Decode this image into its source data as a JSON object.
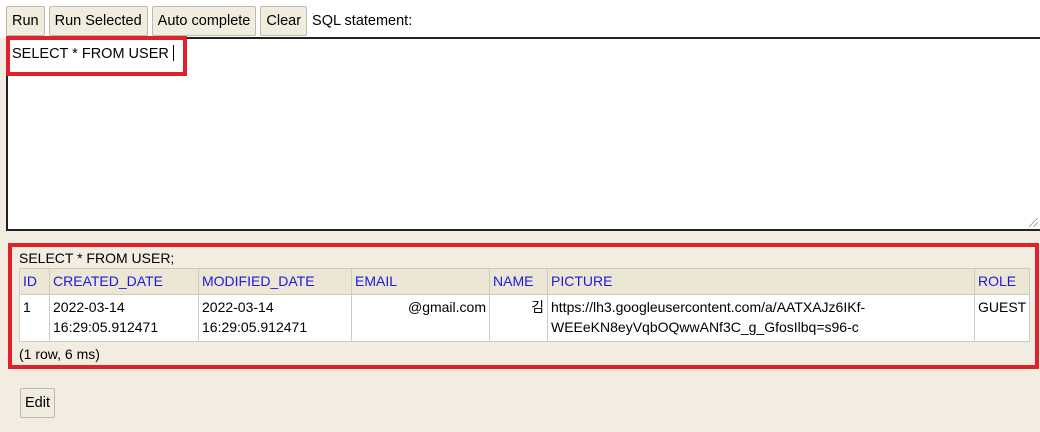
{
  "toolbar": {
    "run_label": "Run",
    "run_selected_label": "Run Selected",
    "auto_complete_label": "Auto complete",
    "clear_label": "Clear",
    "sql_statement_label": "SQL statement:"
  },
  "editor": {
    "value": "SELECT * FROM USER"
  },
  "results": {
    "statement": "SELECT * FROM USER;",
    "columns": [
      "ID",
      "CREATED_DATE",
      "MODIFIED_DATE",
      "EMAIL",
      "NAME",
      "PICTURE",
      "ROLE"
    ],
    "rows": [
      {
        "id": "1",
        "created_date_line1": "2022-03-14",
        "created_date_line2": "16:29:05.912471",
        "modified_date_line1": "2022-03-14",
        "modified_date_line2": "16:29:05.912471",
        "email": "@gmail.com",
        "name": "김",
        "picture_line1": "https://lh3.googleusercontent.com/a/AATXAJz6IKf-",
        "picture_line2": "WEEeKN8eyVqbOQwwANf3C_g_GfosIlbq=s96-c",
        "role": "GUEST"
      }
    ],
    "summary": "(1 row, 6 ms)"
  },
  "edit_label": "Edit",
  "colors": {
    "highlight": "#e0202a",
    "header_link": "#1a1adc",
    "background": "#f2ede0"
  }
}
